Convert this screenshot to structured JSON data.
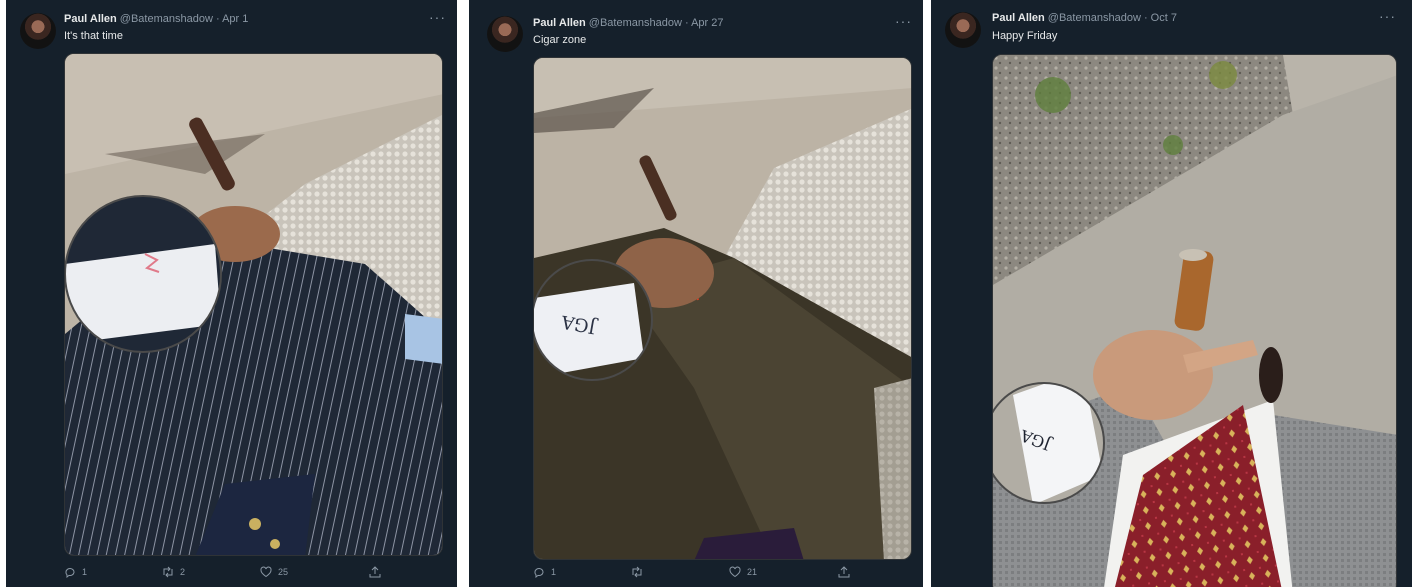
{
  "tweets": [
    {
      "author": {
        "name": "Paul Allen",
        "handle": "@Batemanshadow",
        "date": "· Apr 1"
      },
      "text": "It's that time",
      "stats": {
        "replies": "1",
        "retweets": "2",
        "likes": "25"
      }
    },
    {
      "author": {
        "name": "Paul Allen",
        "handle": "@Batemanshadow",
        "date": "· Apr 27"
      },
      "text": "Cigar zone",
      "stats": {
        "replies": "1",
        "retweets": "",
        "likes": "21"
      }
    },
    {
      "author": {
        "name": "Paul Allen",
        "handle": "@Batemanshadow",
        "date": "· Oct 7"
      },
      "text": "Happy Friday",
      "stats": {
        "replies": "",
        "retweets": "",
        "likes": ""
      }
    }
  ],
  "icons": {
    "more": "more-icon",
    "reply": "reply-icon",
    "retweet": "retweet-icon",
    "like": "heart-icon",
    "share": "share-icon"
  },
  "colors": {
    "background": "#15202b",
    "text": "#e7e9ea",
    "muted": "#8b98a5"
  }
}
